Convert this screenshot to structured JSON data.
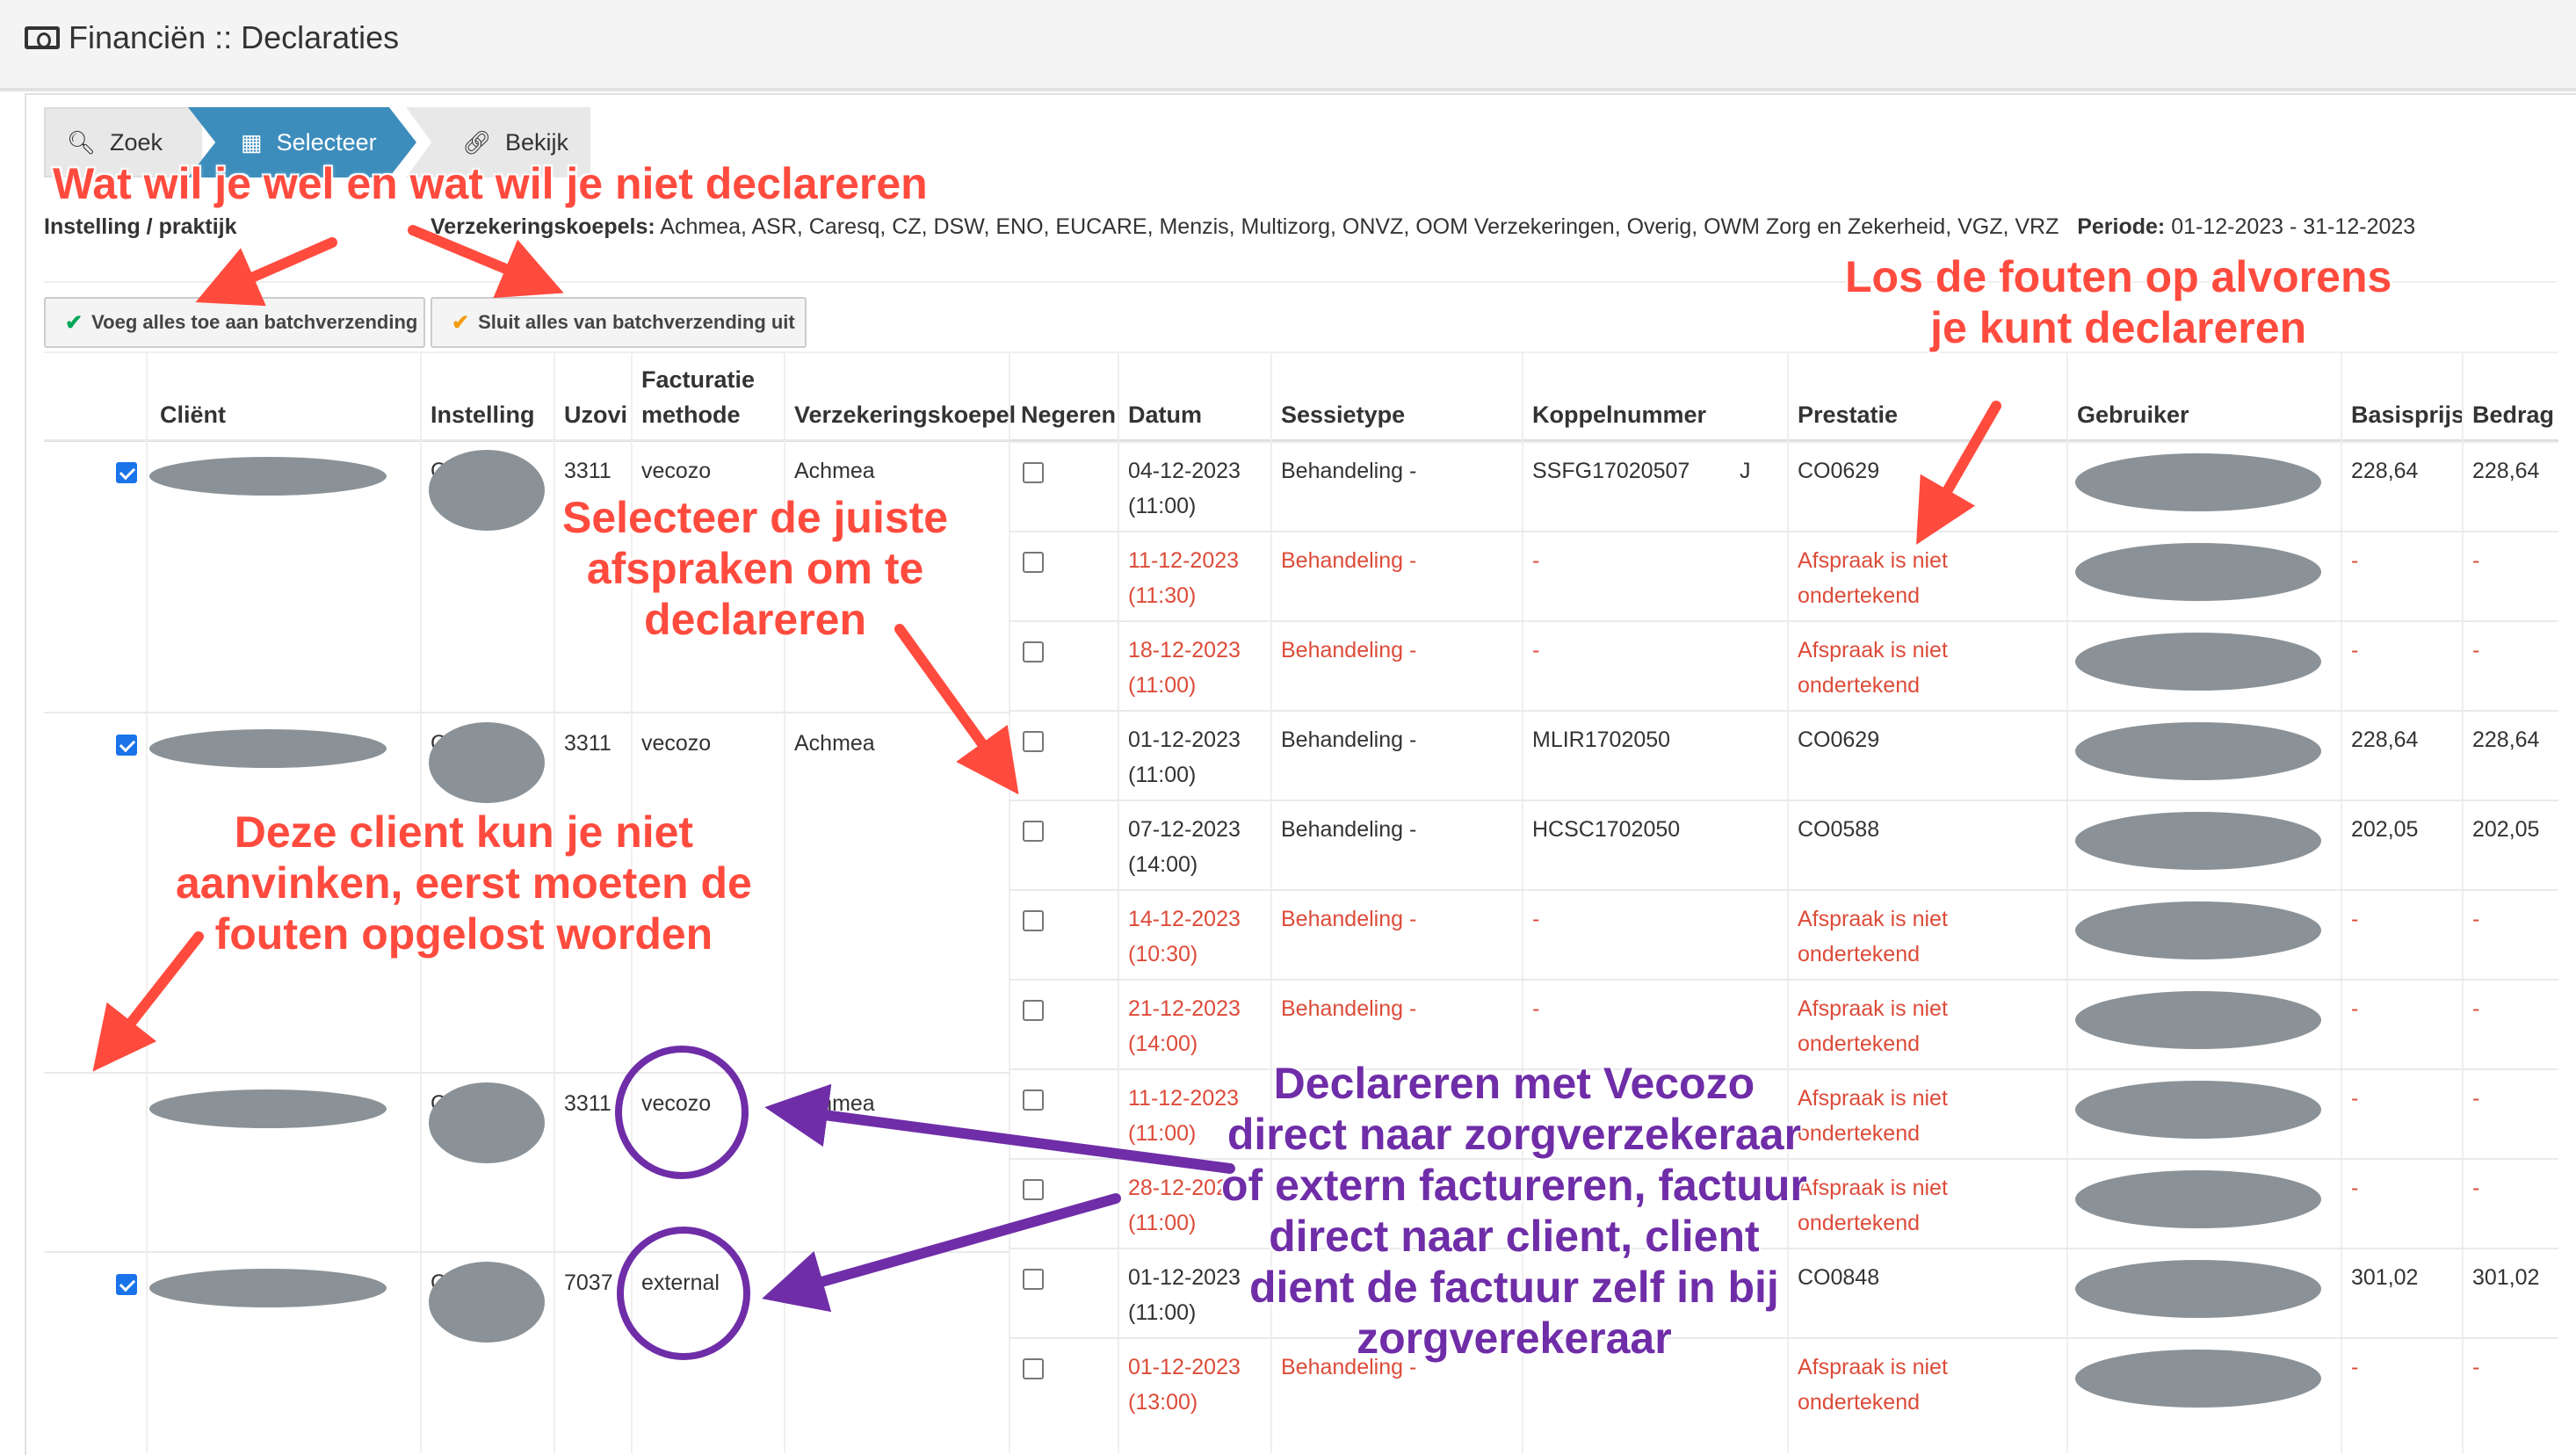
{
  "header": {
    "title": "Financiën :: Declaraties",
    "icon": "money-icon"
  },
  "wizard": {
    "steps": [
      {
        "label": "Zoek",
        "icon": "search-icon"
      },
      {
        "label": "Selecteer",
        "icon": "table-icon",
        "active": true
      },
      {
        "label": "Bekijk",
        "icon": "link-icon"
      }
    ]
  },
  "info": {
    "instelling_label": "Instelling / praktijk",
    "verz_label": "Verzekeringskoepels:",
    "verz_value": "Achmea, ASR, Caresq, CZ, DSW, ENO, EUCARE, Menzis, Multizorg, ONVZ, OOM Verzekeringen, Overig, OWM Zorg en Zekerheid, VGZ, VRZ",
    "periode_label": "Periode:",
    "periode_value": "01-12-2023 - 31-12-2023"
  },
  "buttons": {
    "add_all": "Voeg alles toe aan batchverzending",
    "exclude_all": "Sluit alles van batchverzending uit"
  },
  "table": {
    "headers": {
      "client": "Cliënt",
      "instelling": "Instelling",
      "uzovi": "Uzovi",
      "facturatie1": "Facturatie",
      "facturatie2": "methode",
      "koepel": "Verzekeringskoepel",
      "negeren": "Negeren",
      "datum": "Datum",
      "sessietype": "Sessietype",
      "koppel": "Koppelnummer",
      "prestatie": "Prestatie",
      "gebruiker": "Gebruiker",
      "basisprijs": "Basisprijs",
      "bedrag": "Bedrag"
    },
    "clients": [
      {
        "uzovi": "3311",
        "methode": "vecozo",
        "koepel": "Achmea",
        "inst_prefix": "C"
      },
      {
        "uzovi": "3311",
        "methode": "vecozo",
        "koepel": "Achmea",
        "inst_prefix": "C"
      },
      {
        "uzovi": "3311",
        "methode": "vecozo",
        "koepel": "Achmea",
        "inst_prefix": "C"
      },
      {
        "uzovi": "7037",
        "methode": "external",
        "koepel": "",
        "inst_prefix": "C"
      }
    ],
    "rows": [
      {
        "d1": "04-12-2023",
        "d2": "(11:00)",
        "sessie": "Behandeling -",
        "koppel": "SSFG17020507",
        "koppel_tail": "J",
        "prest1": "CO0629",
        "prest2": "",
        "basis": "228,64",
        "bedrag": "228,64",
        "err": false
      },
      {
        "d1": "11-12-2023",
        "d2": "(11:30)",
        "sessie": "Behandeling -",
        "koppel": "-",
        "koppel_tail": "",
        "prest1": "Afspraak is niet",
        "prest2": "ondertekend",
        "basis": "-",
        "bedrag": "-",
        "err": true
      },
      {
        "d1": "18-12-2023",
        "d2": "(11:00)",
        "sessie": "Behandeling -",
        "koppel": "-",
        "koppel_tail": "",
        "prest1": "Afspraak is niet",
        "prest2": "ondertekend",
        "basis": "-",
        "bedrag": "-",
        "err": true
      },
      {
        "d1": "01-12-2023",
        "d2": "(11:00)",
        "sessie": "Behandeling -",
        "koppel": "MLIR1702050",
        "koppel_tail": "",
        "prest1": "CO0629",
        "prest2": "",
        "basis": "228,64",
        "bedrag": "228,64",
        "err": false
      },
      {
        "d1": "07-12-2023",
        "d2": "(14:00)",
        "sessie": "Behandeling -",
        "koppel": "HCSC1702050",
        "koppel_tail": "",
        "prest1": "CO0588",
        "prest2": "",
        "basis": "202,05",
        "bedrag": "202,05",
        "err": false
      },
      {
        "d1": "14-12-2023",
        "d2": "(10:30)",
        "sessie": "Behandeling -",
        "koppel": "-",
        "koppel_tail": "",
        "prest1": "Afspraak is niet",
        "prest2": "ondertekend",
        "basis": "-",
        "bedrag": "-",
        "err": true
      },
      {
        "d1": "21-12-2023",
        "d2": "(14:00)",
        "sessie": "Behandeling -",
        "koppel": "-",
        "koppel_tail": "",
        "prest1": "Afspraak is niet",
        "prest2": "ondertekend",
        "basis": "-",
        "bedrag": "-",
        "err": true
      },
      {
        "d1": "11-12-2023",
        "d2": "(11:00)",
        "sessie": "",
        "koppel": "",
        "koppel_tail": "",
        "prest1": "Afspraak is niet",
        "prest2": "ondertekend",
        "basis": "-",
        "bedrag": "-",
        "err": true
      },
      {
        "d1": "28-12-202",
        "d2": "(11:00)",
        "sessie": "",
        "koppel": "",
        "koppel_tail": "",
        "prest1": "Afspraak is niet",
        "prest2": "ondertekend",
        "basis": "-",
        "bedrag": "-",
        "err": true
      },
      {
        "d1": "01-12-2023",
        "d2": "(11:00)",
        "sessie": "",
        "koppel": "",
        "koppel_tail": "",
        "prest1": "CO0848",
        "prest2": "",
        "basis": "301,02",
        "bedrag": "301,02",
        "err": false
      },
      {
        "d1": "01-12-2023",
        "d2": "(13:00)",
        "sessie": "Behandeling -",
        "koppel": "",
        "koppel_tail": "",
        "prest1": "Afspraak is niet",
        "prest2": "ondertekend",
        "basis": "-",
        "bedrag": "-",
        "err": true
      }
    ]
  },
  "annotations": {
    "a1": "Wat wil je wel en wat wil je niet declareren",
    "a2_l1": "Los de fouten op alvorens",
    "a2_l2": "je kunt declareren",
    "a3_l1": "Selecteer de juiste",
    "a3_l2": "afspraken om te",
    "a3_l3": "declareren",
    "a4_l1": "Deze client kun je niet",
    "a4_l2": "aanvinken, eerst moeten de",
    "a4_l3": "fouten opgelost worden",
    "a5_l1": "Declareren met Vecozo",
    "a5_l2": "direct naar zorgverzekeraar",
    "a5_l3": "of extern factureren, factuur",
    "a5_l4": "direct naar client, client",
    "a5_l5": "dient de factuur zelf in bij",
    "a5_l6": "zorgverekeraar",
    "red_color": "#ff4b3e",
    "purple_color": "#6f2da8"
  }
}
